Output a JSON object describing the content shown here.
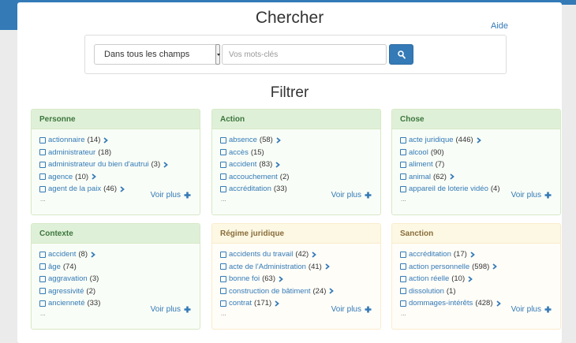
{
  "search": {
    "title": "Chercher",
    "help_label": "Aide",
    "scope_value": "Dans tous les champs",
    "placeholder": "Vos mots-clés"
  },
  "filter_title": "Filtrer",
  "more_label": "Voir plus",
  "ellipsis": "...",
  "colors": {
    "accent": "#337ab7",
    "success_header": "#dff0d8",
    "warning_header": "#fcf8e3"
  },
  "panels": [
    {
      "title": "Personne",
      "style": "success",
      "items": [
        {
          "label": "actionnaire",
          "count": "(14)",
          "expand": true
        },
        {
          "label": "administrateur",
          "count": "(18)",
          "expand": false
        },
        {
          "label": "administrateur du bien d'autrui",
          "count": "(3)",
          "expand": true
        },
        {
          "label": "agence",
          "count": "(10)",
          "expand": true
        },
        {
          "label": "agent de la paix",
          "count": "(46)",
          "expand": true
        }
      ]
    },
    {
      "title": "Action",
      "style": "success",
      "items": [
        {
          "label": "absence",
          "count": "(58)",
          "expand": true
        },
        {
          "label": "accès",
          "count": "(15)",
          "expand": false
        },
        {
          "label": "accident",
          "count": "(83)",
          "expand": true
        },
        {
          "label": "accouchement",
          "count": "(2)",
          "expand": false
        },
        {
          "label": "accréditation",
          "count": "(33)",
          "expand": false
        }
      ]
    },
    {
      "title": "Chose",
      "style": "success",
      "items": [
        {
          "label": "acte juridique",
          "count": "(446)",
          "expand": true
        },
        {
          "label": "alcool",
          "count": "(90)",
          "expand": false
        },
        {
          "label": "aliment",
          "count": "(7)",
          "expand": false
        },
        {
          "label": "animal",
          "count": "(62)",
          "expand": true
        },
        {
          "label": "appareil de loterie vidéo",
          "count": "(4)",
          "expand": false
        }
      ]
    },
    {
      "title": "Contexte",
      "style": "success",
      "items": [
        {
          "label": "accident",
          "count": "(8)",
          "expand": true
        },
        {
          "label": "âge",
          "count": "(74)",
          "expand": false
        },
        {
          "label": "aggravation",
          "count": "(3)",
          "expand": false
        },
        {
          "label": "agressivité",
          "count": "(2)",
          "expand": false
        },
        {
          "label": "ancienneté",
          "count": "(33)",
          "expand": false
        }
      ]
    },
    {
      "title": "Régime juridique",
      "style": "warning",
      "items": [
        {
          "label": "accidents du travail",
          "count": "(42)",
          "expand": true
        },
        {
          "label": "acte de l'Administration",
          "count": "(41)",
          "expand": true
        },
        {
          "label": "bonne foi",
          "count": "(63)",
          "expand": true
        },
        {
          "label": "construction de bâtiment",
          "count": "(24)",
          "expand": true
        },
        {
          "label": "contrat",
          "count": "(171)",
          "expand": true
        }
      ]
    },
    {
      "title": "Sanction",
      "style": "warning",
      "items": [
        {
          "label": "accréditation",
          "count": "(17)",
          "expand": true
        },
        {
          "label": "action personnelle",
          "count": "(598)",
          "expand": true
        },
        {
          "label": "action réelle",
          "count": "(10)",
          "expand": true
        },
        {
          "label": "dissolution",
          "count": "(1)",
          "expand": false
        },
        {
          "label": "dommages-intérêts",
          "count": "(428)",
          "expand": true
        }
      ]
    }
  ]
}
